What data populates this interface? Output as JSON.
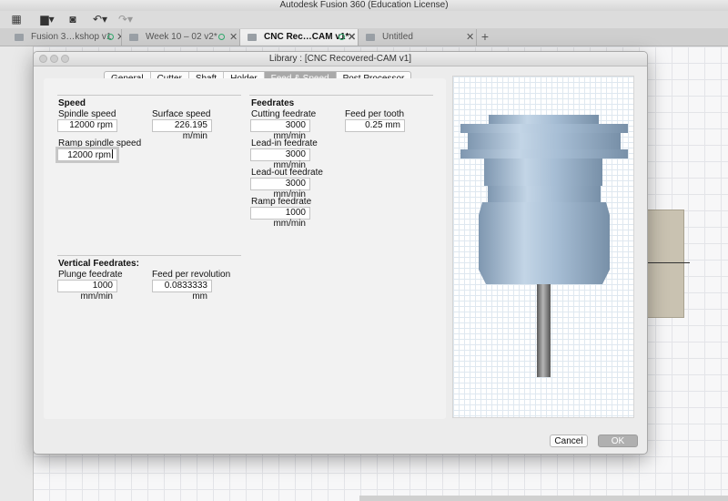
{
  "app": {
    "title": "Autodesk Fusion 360 (Education License)"
  },
  "doc_tabs": [
    {
      "label": "Fusion 3…kshop v1"
    },
    {
      "label": "Week 10 – 02 v2*"
    },
    {
      "label": "CNC Rec…CAM v1*"
    },
    {
      "label": "Untitled"
    }
  ],
  "dialog": {
    "title": "Library : [CNC Recovered-CAM v1]",
    "tabs": [
      "General",
      "Cutter",
      "Shaft",
      "Holder",
      "Feed & Speed",
      "Post Processor"
    ],
    "active_tab": "Feed & Speed",
    "speed": {
      "heading": "Speed",
      "spindle_speed_label": "Spindle speed",
      "spindle_speed": "12000 rpm",
      "surface_speed_label": "Surface speed",
      "surface_speed": "226.195 m/min",
      "ramp_spindle_speed_label": "Ramp spindle speed",
      "ramp_spindle_speed": "12000 rpm"
    },
    "feedrates": {
      "heading": "Feedrates",
      "cutting_feedrate_label": "Cutting feedrate",
      "cutting_feedrate": "3000 mm/min",
      "feed_per_tooth_label": "Feed per tooth",
      "feed_per_tooth": "0.25 mm",
      "lead_in_label": "Lead-in feedrate",
      "lead_in": "3000 mm/min",
      "lead_out_label": "Lead-out feedrate",
      "lead_out": "3000 mm/min",
      "ramp_label": "Ramp feedrate",
      "ramp": "1000 mm/min"
    },
    "vertical": {
      "heading": "Vertical Feedrates:",
      "plunge_label": "Plunge feedrate",
      "plunge": "1000 mm/min",
      "feed_per_rev_label": "Feed per revolution",
      "feed_per_rev": "0.0833333 mm"
    },
    "buttons": {
      "cancel": "Cancel",
      "ok": "OK"
    }
  },
  "colors": {
    "tool_body": "#a9bfd6",
    "tool_shaft": "#7d7d7d"
  }
}
